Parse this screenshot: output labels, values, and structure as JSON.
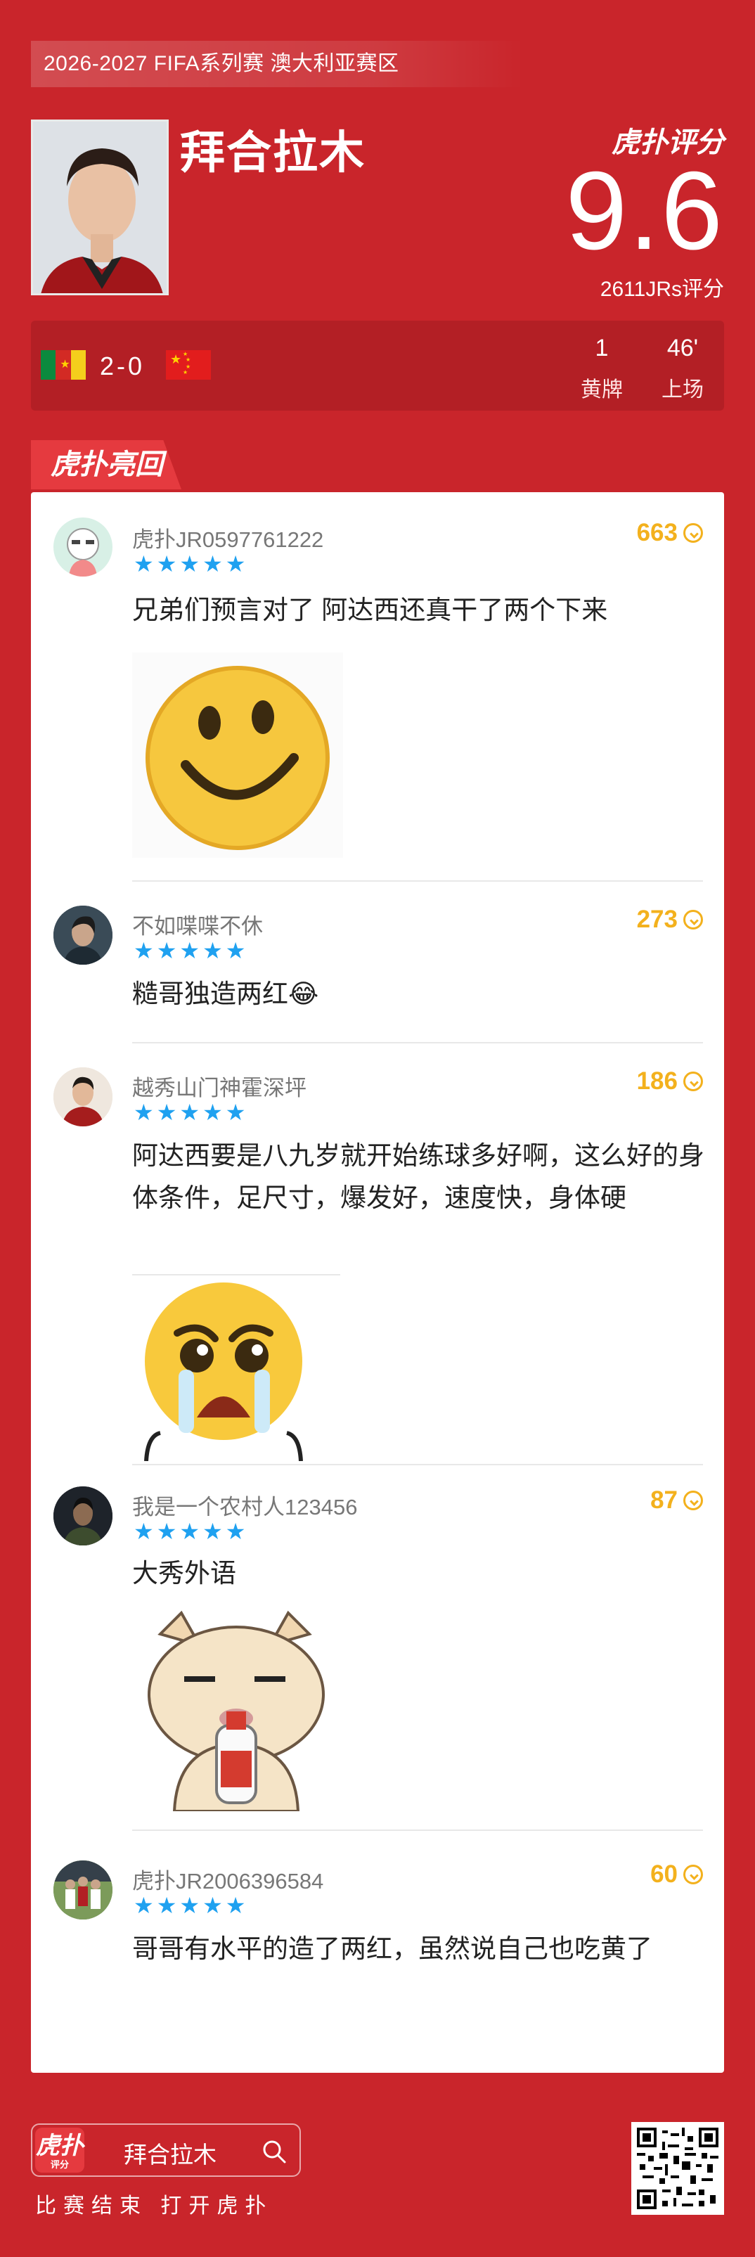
{
  "header": {
    "competition": "2026-2027 FIFA系列赛 澳大利亚赛区",
    "player_name": "拜合拉木",
    "brand_score_label": "虎扑评分",
    "score": "9.6",
    "score_count": "2611JRs评分"
  },
  "match": {
    "score": "2-0",
    "stats": [
      {
        "value": "1",
        "label": "黄牌"
      },
      {
        "value": "46'",
        "label": "上场"
      }
    ]
  },
  "section_tag": "虎扑亮回复",
  "comments": [
    {
      "user": "虎扑JR0597761222",
      "stars": 5,
      "likes": "663",
      "text": "兄弟们预言对了 阿达西还真干了两个下来",
      "sticker": "smile-face-sticker"
    },
    {
      "user": "不如喋喋不休",
      "stars": 5,
      "likes": "273",
      "text": "糙哥独造两红😂",
      "sticker": null
    },
    {
      "user": "越秀山门神霍深坪",
      "stars": 5,
      "likes": "186",
      "text": "阿达西要是八九岁就开始练球多好啊，这么好的身体条件，足尺寸，爆发好，速度快，身体硬",
      "sticker": "crying-face-sticker"
    },
    {
      "user": "我是一个农村人123456",
      "stars": 5,
      "likes": "87",
      "text": "大秀外语",
      "sticker": "shiba-dog-drinking-sticker"
    },
    {
      "user": "虎扑JR2006396584",
      "stars": 5,
      "likes": "60",
      "text": "哥哥有水平的造了两红，虽然说自己也吃黄了",
      "sticker": null
    }
  ],
  "footer": {
    "logo_text": "虎扑",
    "logo_sub": "评分",
    "search_name": "拜合拉木",
    "slogan": "比赛结束 打开虎扑"
  },
  "colors": {
    "background": "#c9252b",
    "accent_star": "#1fa1f0",
    "likes": "#f3b11d"
  }
}
